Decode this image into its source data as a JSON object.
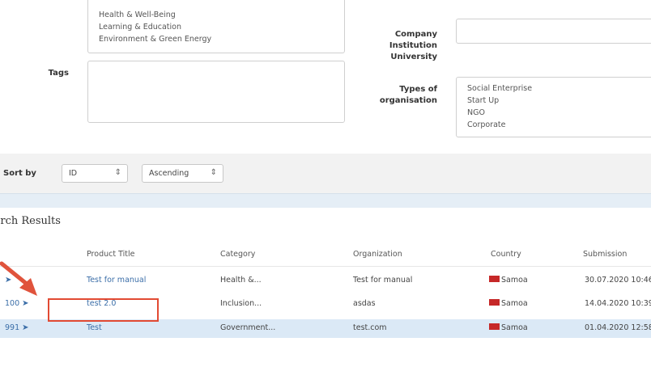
{
  "categories_list": {
    "items": [
      "Health & Well-Being",
      "Learning & Education",
      "Environment & Green Energy"
    ]
  },
  "tags": {
    "label": "Tags",
    "value": ""
  },
  "company": {
    "label_lines": [
      "Company",
      "Institution",
      "University"
    ],
    "value": ""
  },
  "org_types": {
    "label_lines": [
      "Types of",
      "organisation"
    ],
    "items": [
      "Social Enterprise",
      "Start Up",
      "NGO",
      "Corporate"
    ]
  },
  "sort": {
    "label": "Sort by",
    "field_value": "ID",
    "order_value": "Ascending"
  },
  "results": {
    "title": "Search Results",
    "columns": [
      "Product Title",
      "Category",
      "Organization",
      "Country",
      "Submission"
    ],
    "rows": [
      {
        "id": "",
        "title": "Test for manual",
        "category": "Health &...",
        "organization": "Test for manual",
        "country": "Samoa",
        "submission": "30.07.2020 10:46"
      },
      {
        "id": "100",
        "title": "test 2.0",
        "category": "Inclusion...",
        "organization": "asdas",
        "country": "Samoa",
        "submission": "14.04.2020 10:39"
      },
      {
        "id": "991",
        "title": "Test",
        "category": "Government...",
        "organization": "test.com",
        "country": "Samoa",
        "submission": "01.04.2020 12:58"
      }
    ]
  },
  "colors": {
    "highlight_box": "#e24a33",
    "arrow": "#e0533c",
    "link": "#3b6ea8",
    "flag": "#c62828"
  }
}
